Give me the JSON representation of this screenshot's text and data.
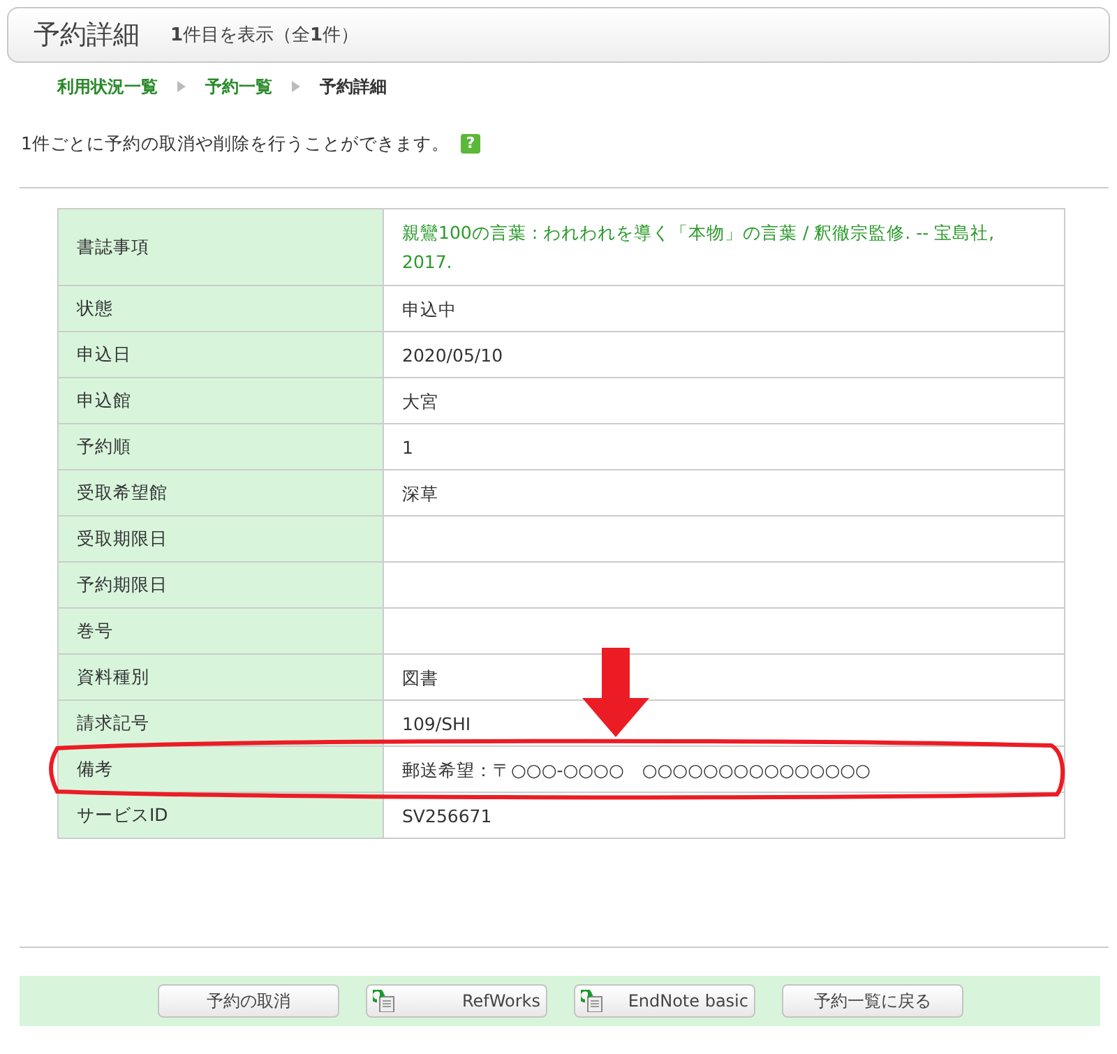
{
  "header": {
    "title": "予約詳細",
    "subtitle": "**1**件目を表示（全**1**件）"
  },
  "breadcrumbs": [
    {
      "label": "利用状況一覧",
      "kind": "link"
    },
    {
      "label": "予約一覧",
      "kind": "link"
    },
    {
      "label": "予約詳細",
      "kind": "current"
    }
  ],
  "description": "1件ごとに予約の取消や削除を行うことができます。",
  "help": {
    "label": "?"
  },
  "rows": [
    {
      "label": "書誌事項",
      "value": "親鸞100の言葉 : われわれを導く「本物」の言葉 / 釈徹宗監修. -- 宝島社, 2017.",
      "kind": "link",
      "annotated": false
    },
    {
      "label": "状態",
      "value": "申込中",
      "kind": "text",
      "annotated": false
    },
    {
      "label": "申込日",
      "value": "2020/05/10",
      "kind": "text",
      "annotated": false
    },
    {
      "label": "申込館",
      "value": "大宮",
      "kind": "text",
      "annotated": false
    },
    {
      "label": "予約順",
      "value": "1",
      "kind": "text",
      "annotated": false
    },
    {
      "label": "受取希望館",
      "value": "深草",
      "kind": "text",
      "annotated": false
    },
    {
      "label": "受取期限日",
      "kind": "text",
      "annotated": false
    },
    {
      "label": "予約期限日",
      "kind": "text",
      "annotated": false
    },
    {
      "label": "巻号",
      "kind": "text",
      "annotated": false
    },
    {
      "label": "資料種別",
      "value": "図書",
      "kind": "text",
      "annotated": false
    },
    {
      "label": "請求記号",
      "value": "109/SHI",
      "kind": "text",
      "annotated": false
    },
    {
      "label": "備考",
      "value": "郵送希望：〒○○○-○○○○　○○○○○○○○○○○○○○○",
      "kind": "text",
      "annotated": true
    },
    {
      "label": "サービスID",
      "value": "SV256671",
      "kind": "text",
      "annotated": false
    }
  ],
  "buttons": [
    {
      "label": "予約の取消",
      "kind": "plain"
    },
    {
      "label": "RefWorks",
      "kind": "export"
    },
    {
      "label": "EndNote basic",
      "kind": "export"
    },
    {
      "label": "予約一覧に戻る",
      "kind": "plain"
    }
  ]
}
